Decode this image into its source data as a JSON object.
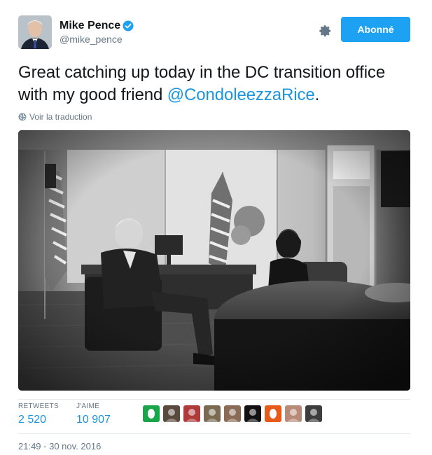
{
  "user": {
    "name": "Mike Pence",
    "handle": "@mike_pence",
    "verified": true
  },
  "actions": {
    "follow_label": "Abonné",
    "settings_icon": "gear-icon"
  },
  "tweet": {
    "text_before": "Great catching up today in the DC transition office with my good friend ",
    "mention": "@CondoleezzaRice",
    "text_after": ".",
    "translate_label": "Voir la traduction"
  },
  "stats": {
    "retweets_label": "RETWEETS",
    "retweets_value": "2 520",
    "likes_label": "J'AIME",
    "likes_value": "10 907"
  },
  "likers": [
    {
      "name": "liker-1",
      "color": "#19a64a"
    },
    {
      "name": "liker-2",
      "color": "#5a4a3e"
    },
    {
      "name": "liker-3",
      "color": "#b03a3a"
    },
    {
      "name": "liker-4",
      "color": "#7a6a52"
    },
    {
      "name": "liker-5",
      "color": "#8a6b55"
    },
    {
      "name": "liker-6",
      "color": "#111111"
    },
    {
      "name": "liker-7",
      "color": "#e85a1a"
    },
    {
      "name": "liker-8",
      "color": "#b88a78"
    },
    {
      "name": "liker-9",
      "color": "#3d3d3d"
    }
  ],
  "timestamp": "21:49 - 30 nov. 2016",
  "colors": {
    "accent": "#1da1f2",
    "link": "#1b95e0",
    "muted": "#657786"
  }
}
